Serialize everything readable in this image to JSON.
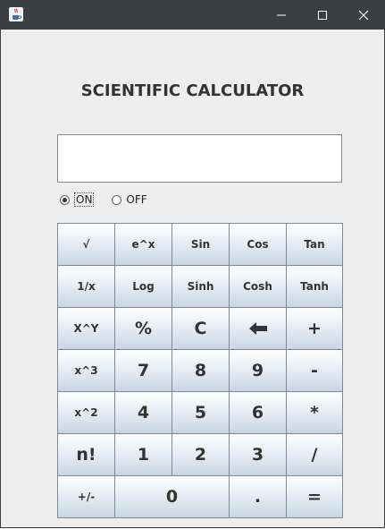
{
  "window": {
    "app_icon": "java-cup-icon"
  },
  "header": {
    "title": "SCIENTIFIC CALCULATOR"
  },
  "display": {
    "value": ""
  },
  "power": {
    "on_label": "ON",
    "off_label": "OFF",
    "selected": "ON"
  },
  "keypad": {
    "row1": [
      "√",
      "e^x",
      "Sin",
      "Cos",
      "Tan"
    ],
    "row2": [
      "1/x",
      "Log",
      "Sinh",
      "Cosh",
      "Tanh"
    ],
    "row3": [
      "X^Y",
      "%",
      "C",
      "+"
    ],
    "row4": [
      "x^3",
      "7",
      "8",
      "9",
      "-"
    ],
    "row5": [
      "x^2",
      "4",
      "5",
      "6",
      "*"
    ],
    "row6": [
      "n!",
      "1",
      "2",
      "3",
      "/"
    ],
    "row7": [
      "+/-",
      "0",
      ".",
      "="
    ],
    "backspace_icon": "left-arrow-icon"
  }
}
